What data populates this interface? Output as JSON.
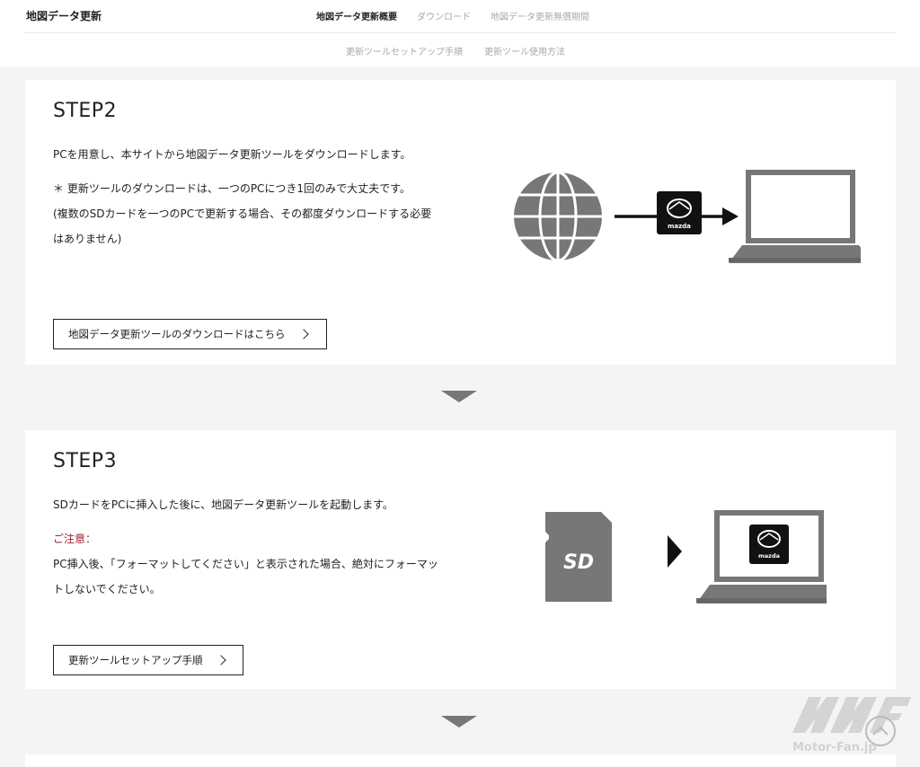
{
  "header": {
    "site_title": "地図データ更新",
    "nav_row1": [
      {
        "label": "地図データ更新概要",
        "active": true
      },
      {
        "label": "ダウンロード",
        "active": false
      },
      {
        "label": "地図データ更新無償期間",
        "active": false
      }
    ],
    "nav_row2": [
      {
        "label": "更新ツールセットアップ手順"
      },
      {
        "label": "更新ツール使用方法"
      }
    ]
  },
  "step2": {
    "title": "STEP2",
    "para1": "PCを用意し、本サイトから地図データ更新ツールをダウンロードします。",
    "para2": "＊ 更新ツールのダウンロードは、一つのPCにつき1回のみで大丈夫です。",
    "para3": "(複数のSDカードを一つのPCで更新する場合、その都度ダウンロードする必要はありません)",
    "button_label": "地図データ更新ツールのダウンロードはこちら",
    "illustration": {
      "icons": [
        "globe-icon",
        "mazda-tool-icon",
        "laptop-icon"
      ],
      "logo_text": "mazda"
    }
  },
  "step3": {
    "title": "STEP3",
    "para1": "SDカードをPCに挿入した後に、地図データ更新ツールを起動します。",
    "caution_label": "ご注意：",
    "caution_text": "PC挿入後、「フォーマットしてください」と表示された場合、絶対にフォーマットしないでください。",
    "button_label": "更新ツールセットアップ手順",
    "illustration": {
      "icons": [
        "sd-card-icon",
        "laptop-icon"
      ],
      "sd_text": "SD",
      "logo_text": "mazda"
    }
  },
  "watermark": {
    "brand": "Motor-Fan.jp"
  },
  "colors": {
    "background": "#f4f4f4",
    "card": "#ffffff",
    "caution": "#a0202e",
    "illustration_gray": "#777777",
    "nav_inactive": "#a8a8a8"
  }
}
